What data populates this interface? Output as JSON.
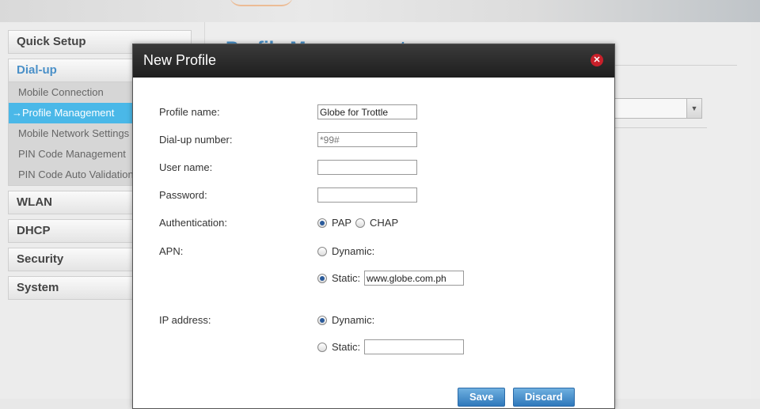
{
  "sidebar": {
    "quick_setup": "Quick Setup",
    "dialup": "Dial-up",
    "dialup_items": [
      "Mobile Connection",
      "→Profile Management",
      "Mobile Network Settings",
      "PIN Code Management",
      "PIN Code Auto Validation"
    ],
    "wlan": "WLAN",
    "dhcp": "DHCP",
    "security": "Security",
    "system": "System"
  },
  "background": {
    "title": "Profile Management",
    "select_arrow_icon": "chevron-down-icon"
  },
  "modal": {
    "title": "New Profile",
    "close_icon": "close-icon",
    "profile_name_label": "Profile name:",
    "profile_name_value": "Globe for Trottle",
    "dialup_number_label": "Dial-up number:",
    "dialup_number_placeholder": "*99#",
    "username_label": "User name:",
    "username_value": "",
    "password_label": "Password:",
    "password_value": "",
    "auth_label": "Authentication:",
    "auth_pap": "PAP",
    "auth_chap": "CHAP",
    "apn_label": "APN:",
    "apn_dynamic": "Dynamic:",
    "apn_static": "Static:",
    "apn_static_value": "www.globe.com.ph",
    "ip_label": "IP address:",
    "ip_dynamic": "Dynamic:",
    "ip_static": "Static:",
    "ip_static_value": "",
    "save": "Save",
    "discard": "Discard"
  },
  "colors": {
    "accent": "#4a90c8",
    "selected_item": "#4ab8e8",
    "close": "#c8202a"
  }
}
